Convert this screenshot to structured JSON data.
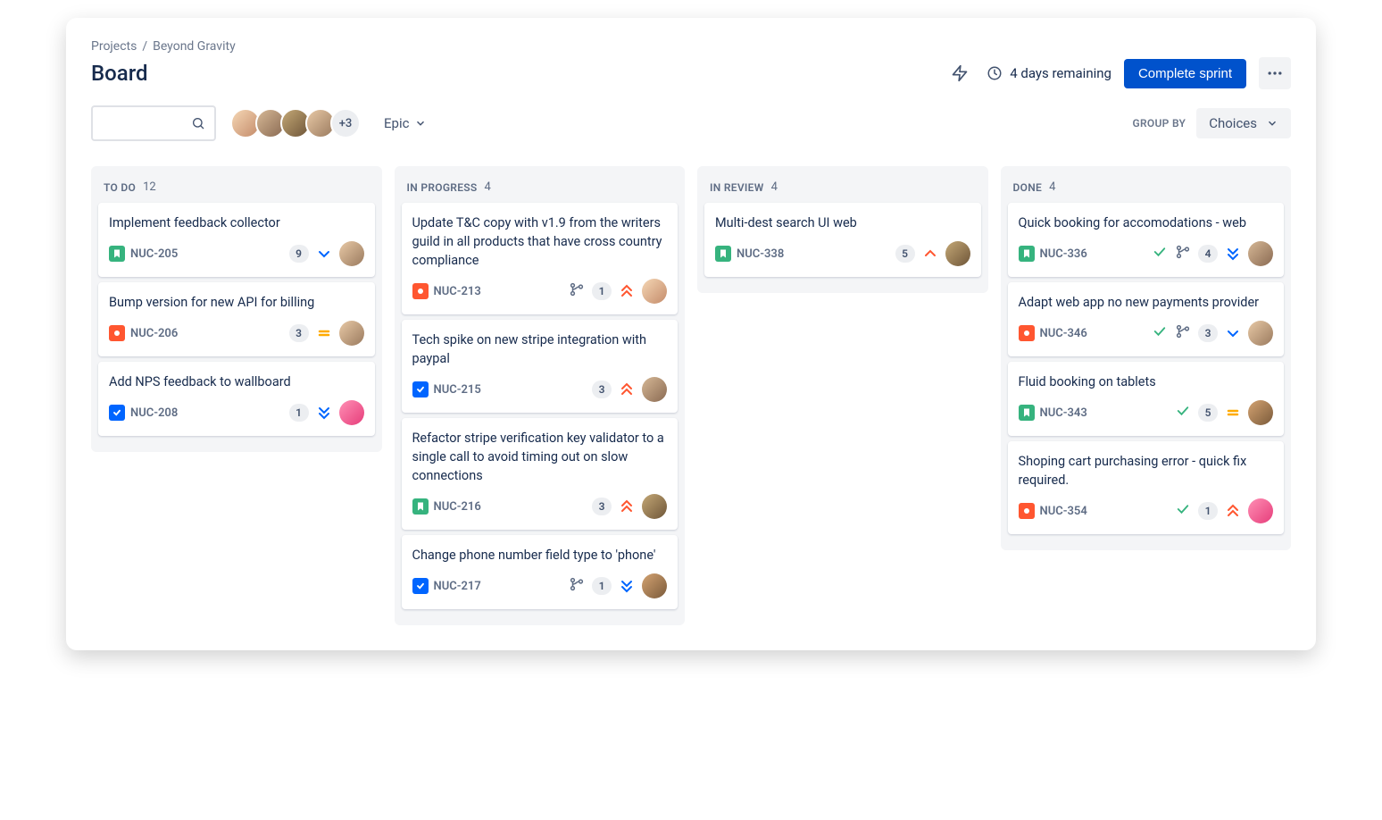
{
  "breadcrumb": {
    "root": "Projects",
    "project": "Beyond Gravity"
  },
  "page_title": "Board",
  "header": {
    "time_remaining": "4 days remaining",
    "complete_sprint_label": "Complete sprint"
  },
  "controls": {
    "search_placeholder": "",
    "avatar_overflow": "+3",
    "filter_epic_label": "Epic",
    "group_by_label": "GROUP BY",
    "group_by_value": "Choices"
  },
  "columns": [
    {
      "title": "TO DO",
      "count": "12",
      "cards": [
        {
          "title": "Implement feedback collector",
          "type": "story",
          "key": "NUC-205",
          "points": "9",
          "priority": "low",
          "has_branch": false,
          "has_check": false,
          "avatar": "av-4"
        },
        {
          "title": "Bump version for new API for billing",
          "type": "bug",
          "key": "NUC-206",
          "points": "3",
          "priority": "medium",
          "has_branch": false,
          "has_check": false,
          "avatar": "av-4"
        },
        {
          "title": "Add NPS feedback to wallboard",
          "type": "task",
          "key": "NUC-208",
          "points": "1",
          "priority": "lowest",
          "has_branch": false,
          "has_check": false,
          "avatar": "av-pink"
        }
      ]
    },
    {
      "title": "IN PROGRESS",
      "count": "4",
      "cards": [
        {
          "title": "Update T&C copy with v1.9 from the writers guild in all products that have cross country compliance",
          "type": "bug",
          "key": "NUC-213",
          "points": "1",
          "priority": "highest",
          "has_branch": true,
          "has_check": false,
          "avatar": "av-1"
        },
        {
          "title": "Tech spike on new stripe integration with paypal",
          "type": "task",
          "key": "NUC-215",
          "points": "3",
          "priority": "highest",
          "has_branch": false,
          "has_check": false,
          "avatar": "av-2"
        },
        {
          "title": "Refactor stripe verification key validator to a single call to avoid timing out on slow connections",
          "type": "story",
          "key": "NUC-216",
          "points": "3",
          "priority": "highest",
          "has_branch": false,
          "has_check": false,
          "avatar": "av-3"
        },
        {
          "title": "Change phone number field type to 'phone'",
          "type": "task",
          "key": "NUC-217",
          "points": "1",
          "priority": "lowest",
          "has_branch": true,
          "has_check": false,
          "avatar": "av-5"
        }
      ]
    },
    {
      "title": "IN REVIEW",
      "count": "4",
      "cards": [
        {
          "title": "Multi-dest search UI web",
          "type": "story",
          "key": "NUC-338",
          "points": "5",
          "priority": "high",
          "has_branch": false,
          "has_check": false,
          "avatar": "av-3"
        }
      ]
    },
    {
      "title": "DONE",
      "count": "4",
      "cards": [
        {
          "title": "Quick booking for accomodations - web",
          "type": "story",
          "key": "NUC-336",
          "points": "4",
          "priority": "lowest",
          "has_branch": true,
          "has_check": true,
          "avatar": "av-2"
        },
        {
          "title": "Adapt web app no new payments provider",
          "type": "bug",
          "key": "NUC-346",
          "points": "3",
          "priority": "low",
          "has_branch": true,
          "has_check": true,
          "avatar": "av-4"
        },
        {
          "title": "Fluid booking on tablets",
          "type": "story",
          "key": "NUC-343",
          "points": "5",
          "priority": "medium",
          "has_branch": false,
          "has_check": true,
          "avatar": "av-5"
        },
        {
          "title": "Shoping cart purchasing error - quick fix required.",
          "type": "bug",
          "key": "NUC-354",
          "points": "1",
          "priority": "highest",
          "has_branch": false,
          "has_check": true,
          "avatar": "av-pink"
        }
      ]
    }
  ]
}
